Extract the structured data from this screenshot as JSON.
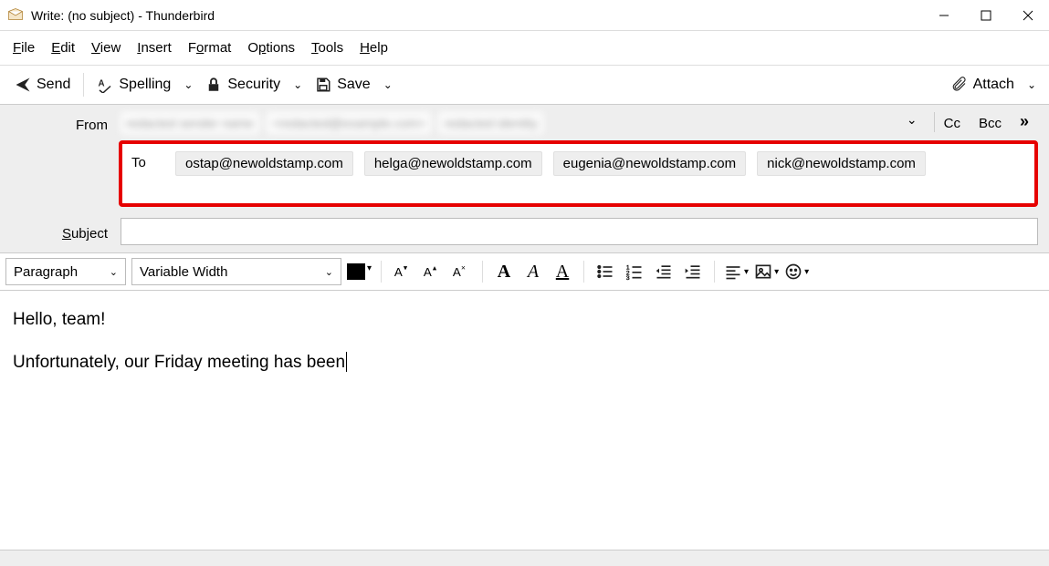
{
  "window": {
    "title": "Write: (no subject) - Thunderbird"
  },
  "menu": {
    "file": "File",
    "edit": "Edit",
    "view": "View",
    "insert": "Insert",
    "format": "Format",
    "options": "Options",
    "tools": "Tools",
    "help": "Help"
  },
  "toolbar": {
    "send": "Send",
    "spelling": "Spelling",
    "security": "Security",
    "save": "Save",
    "attach": "Attach"
  },
  "headers": {
    "from_label": "From",
    "from_blur1": "redacted sender name",
    "from_blur2": "<redacted@example.com>",
    "from_blur3": "redacted identity",
    "cc": "Cc",
    "bcc": "Bcc",
    "to_label": "To",
    "recipients": [
      "ostap@newoldstamp.com",
      "helga@newoldstamp.com",
      "eugenia@newoldstamp.com",
      "nick@newoldstamp.com"
    ],
    "subject_label": "Subject",
    "subject_value": ""
  },
  "format": {
    "paragraph_style": "Paragraph",
    "font_family": "Variable Width"
  },
  "body": {
    "line1": "Hello, team!",
    "line2": "Unfortunately, our Friday meeting has been"
  }
}
